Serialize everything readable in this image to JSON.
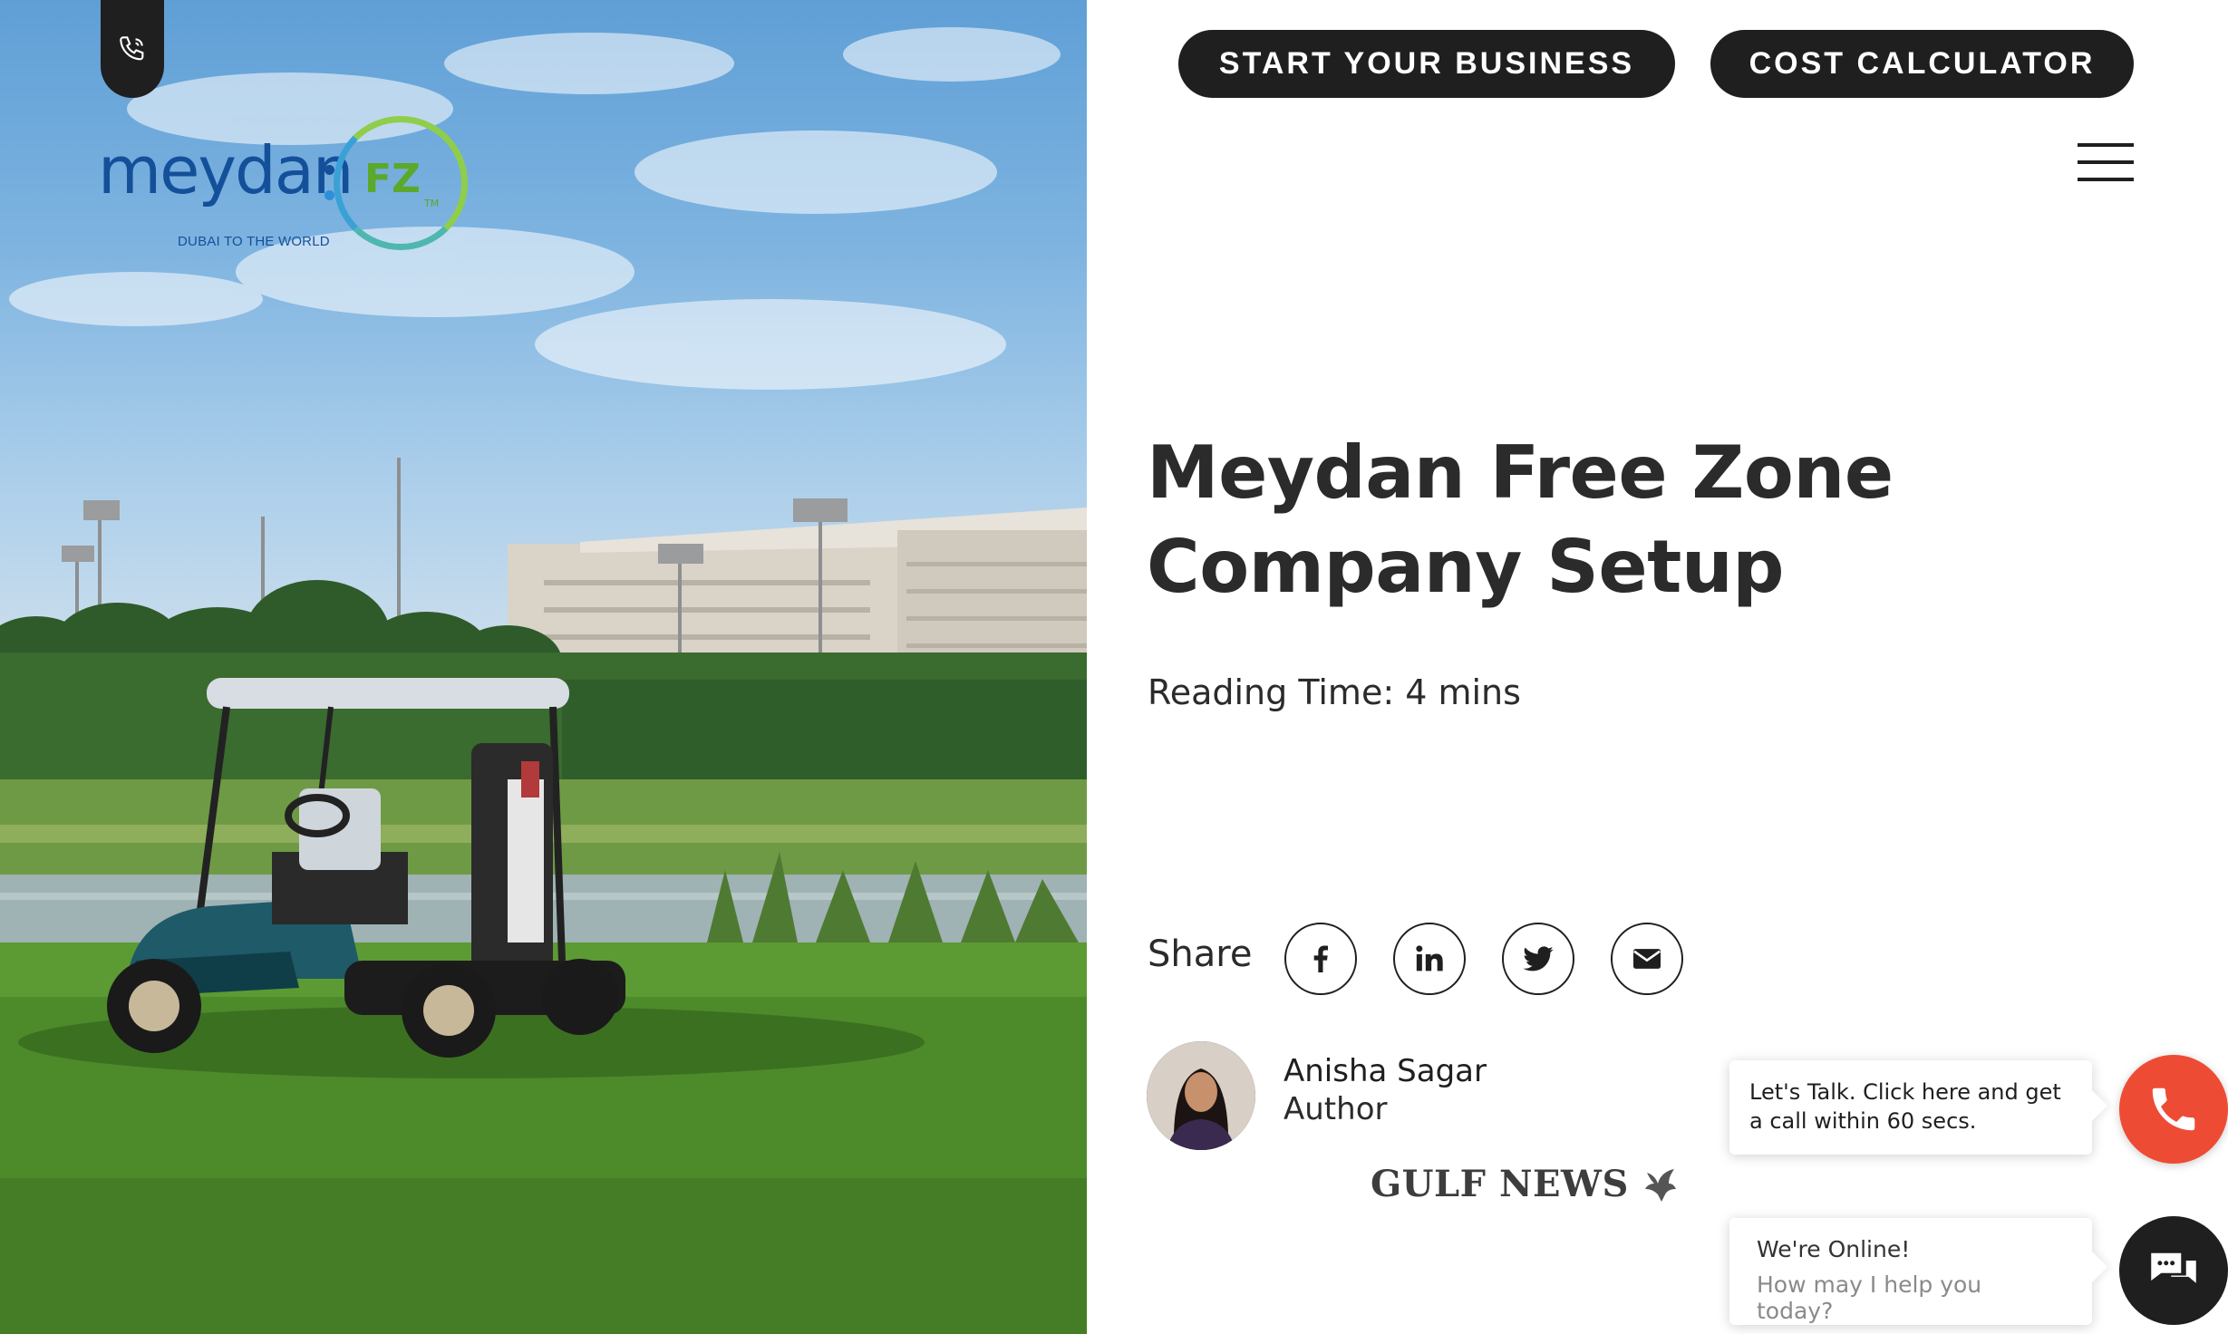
{
  "header": {
    "start_business_label": "START YOUR BUSINESS",
    "cost_calculator_label": "COST CALCULATOR"
  },
  "logo": {
    "wordmark": "meydan",
    "badge": "FZ",
    "trademark": "TM",
    "tagline": "DUBAI TO THE WORLD"
  },
  "article": {
    "title": "Meydan Free Zone Company Setup",
    "reading_time": "Reading Time: 4 mins"
  },
  "share": {
    "label": "Share",
    "icons": [
      "facebook-icon",
      "linkedin-icon",
      "twitter-icon",
      "email-icon"
    ]
  },
  "author": {
    "name": "Anisha Sagar",
    "role": "Author",
    "publication": "GULF NEWS"
  },
  "chat": {
    "call_prompt": "Let's Talk. Click here and get a call within 60 secs.",
    "online_title": "We're Online!",
    "online_subtitle": "How may I help you today?"
  },
  "colors": {
    "dark": "#1f1f1f",
    "brand_blue": "#14509a",
    "brand_green": "#5ca82a",
    "call_red": "#ee4b35"
  }
}
